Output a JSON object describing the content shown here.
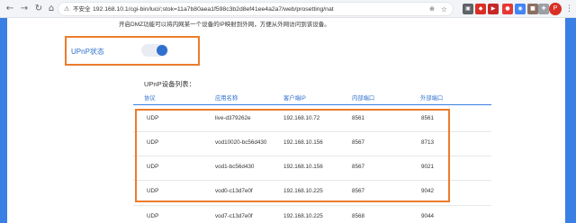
{
  "browser": {
    "security_label": "不安全",
    "url": "192.168.10.1/cgi-bin/luci/;stok=11a7b80aea1f598c3b2d8ef41ee4a2a7/web/prosetting/nat",
    "profile_initial": "P",
    "icons": {
      "back": "back-arrow-icon",
      "forward": "forward-arrow-icon",
      "reload": "reload-icon",
      "home": "home-icon",
      "warning": "warning-icon",
      "star": "star-icon",
      "zoom": "zoom-icon",
      "menu": "more-vert-icon"
    }
  },
  "page": {
    "description": "开启DMZ功能可以将内网某一个设备的IP映射到外网，方便从外网访问到该设备。",
    "upnp_label": "UPnP状态",
    "upnp_enabled": true,
    "list_title": "UPnP设备列表：",
    "accent_color": "#2f6fce",
    "highlight_color": "#ec7c2b"
  },
  "table": {
    "headers": [
      "协议",
      "应用名称",
      "客户端IP",
      "内部端口",
      "外部端口"
    ],
    "rows": [
      [
        "UDP",
        "live-d379262e",
        "192.168.10.72",
        "8561",
        "8561"
      ],
      [
        "UDP",
        "vod10020-bc56d430",
        "192.168.10.156",
        "8567",
        "8713"
      ],
      [
        "UDP",
        "vod1-bc56d430",
        "192.168.10.156",
        "8567",
        "9021"
      ],
      [
        "UDP",
        "vod0-c13d7e0f",
        "192.168.10.225",
        "8567",
        "9042"
      ],
      [
        "UDP",
        "vod7-c13d7e0f",
        "192.168.10.225",
        "8568",
        "9044"
      ]
    ]
  }
}
